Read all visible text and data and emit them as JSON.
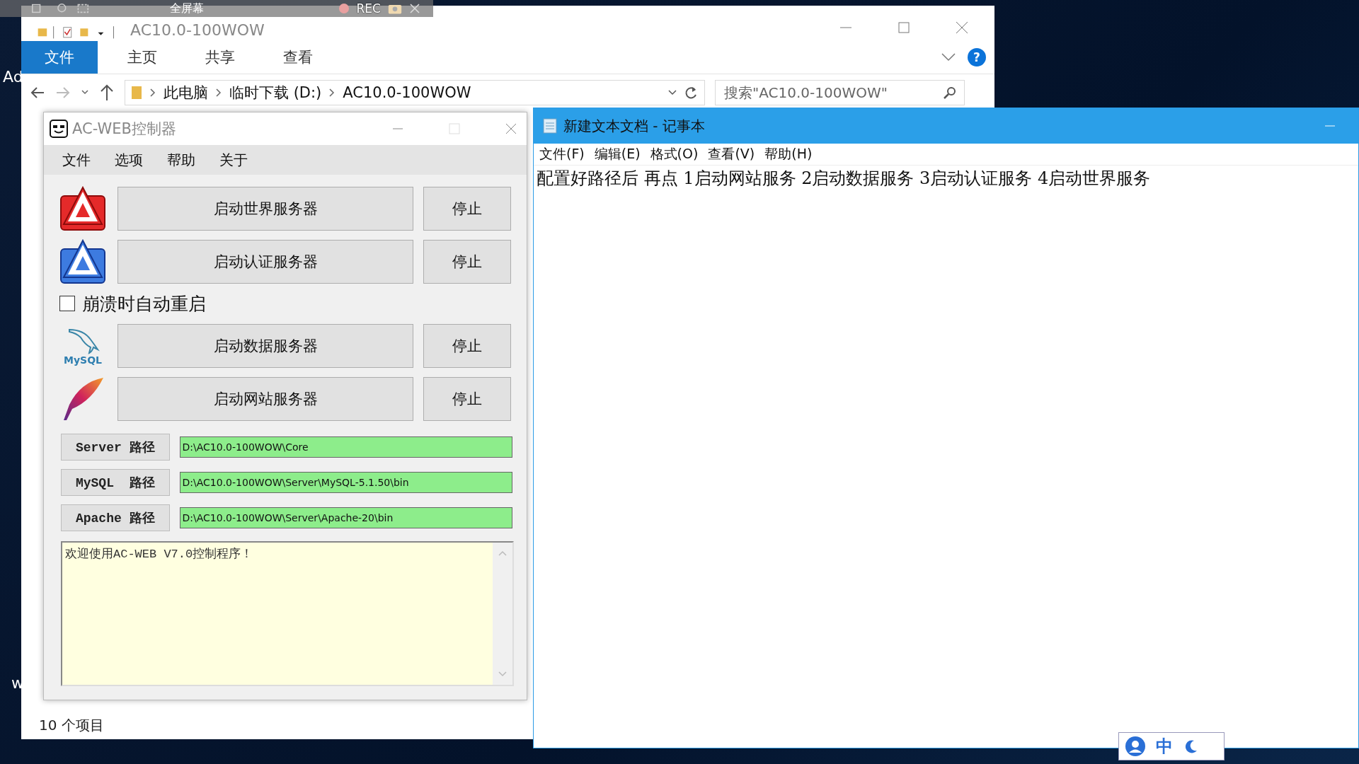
{
  "recorder_bar": {
    "mode": "全屏幕",
    "rec": "REC"
  },
  "desktop": {
    "icon_labels": [
      "Ad",
      "w"
    ]
  },
  "explorer": {
    "title": "AC10.0-100WOW",
    "help": "?",
    "ribbon_tabs": [
      {
        "label": "文件",
        "selected": true
      },
      {
        "label": "主页",
        "selected": false
      },
      {
        "label": "共享",
        "selected": false
      },
      {
        "label": "查看",
        "selected": false
      }
    ],
    "breadcrumb": [
      "此电脑",
      "临时下载 (D:)",
      "AC10.0-100WOW"
    ],
    "search": {
      "placeholder": "搜索\"AC10.0-100WOW\""
    },
    "status_bar": "10 个项目"
  },
  "controller": {
    "title": "AC-WEB控制器",
    "menu": [
      "文件",
      "选项",
      "帮助",
      "关于"
    ],
    "rows": [
      {
        "kind": "world",
        "start": "启动世界服务器",
        "stop": "停止"
      },
      {
        "kind": "auth",
        "start": "启动认证服务器",
        "stop": "停止"
      },
      {
        "kind": "checkbox",
        "label": "崩溃时自动重启",
        "checked": false
      },
      {
        "kind": "database",
        "logo_text": "MySQL",
        "start": "启动数据服务器",
        "stop": "停止"
      },
      {
        "kind": "web",
        "start": "启动网站服务器",
        "stop": "停止"
      }
    ],
    "paths": [
      {
        "label": "Server 路径",
        "value": "D:\\AC10.0-100WOW\\Core"
      },
      {
        "label": "MySQL  路径",
        "value": "D:\\AC10.0-100WOW\\Server\\MySQL-5.1.50\\bin"
      },
      {
        "label": "Apache 路径",
        "value": "D:\\AC10.0-100WOW\\Server\\Apache-20\\bin"
      }
    ],
    "log": "欢迎使用AC-WEB V7.0控制程序！"
  },
  "notepad": {
    "title": "新建文本文档 - 记事本",
    "menu": [
      "文件(F)",
      "编辑(E)",
      "格式(O)",
      "查看(V)",
      "帮助(H)"
    ],
    "text": "配置好路径后 再点 1启动网站服务 2启动数据服务 3启动认证服务 4启动世界服务"
  },
  "ime": {
    "mode": "中"
  }
}
